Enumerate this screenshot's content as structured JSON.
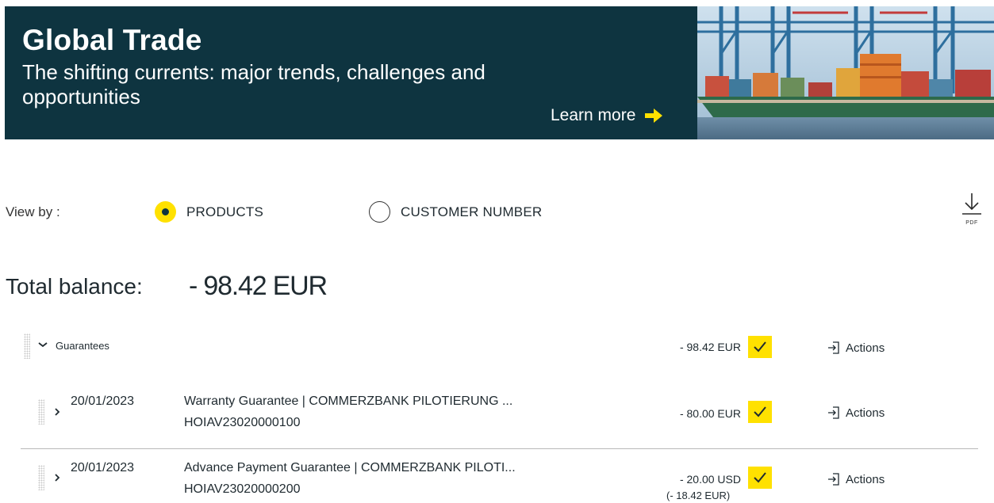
{
  "banner": {
    "title": "Global Trade",
    "subtitle": "The shifting currents: major trends, challenges and opportunities",
    "cta_label": "Learn more",
    "background_color": "#0e3440",
    "accent_color": "#ffe100",
    "image_icon": "container-ship-port-image"
  },
  "view_by": {
    "label": "View by :",
    "options": [
      {
        "label": "PRODUCTS",
        "selected": true
      },
      {
        "label": "CUSTOMER NUMBER",
        "selected": false
      }
    ]
  },
  "pdf": {
    "label": "PDF",
    "icon": "download-icon"
  },
  "balance": {
    "label": "Total balance:",
    "value": "- 98.42 EUR"
  },
  "group": {
    "label": "Guarantees",
    "amount": "- 98.42 EUR",
    "checked": true,
    "actions_label": "Actions",
    "expanded": true
  },
  "rows": [
    {
      "date": "20/01/2023",
      "title": "Warranty Guarantee | COMMERZBANK PILOTIERUNG ...",
      "reference": "HOIAV23020000100",
      "amount": "- 80.00 EUR",
      "amount_converted": "",
      "checked": true,
      "actions_label": "Actions"
    },
    {
      "date": "20/01/2023",
      "title": "Advance Payment Guarantee | COMMERZBANK PILOTI...",
      "reference": "HOIAV23020000200",
      "amount": "- 20.00 USD",
      "amount_converted": "(- 18.42 EUR)",
      "checked": true,
      "actions_label": "Actions"
    }
  ]
}
